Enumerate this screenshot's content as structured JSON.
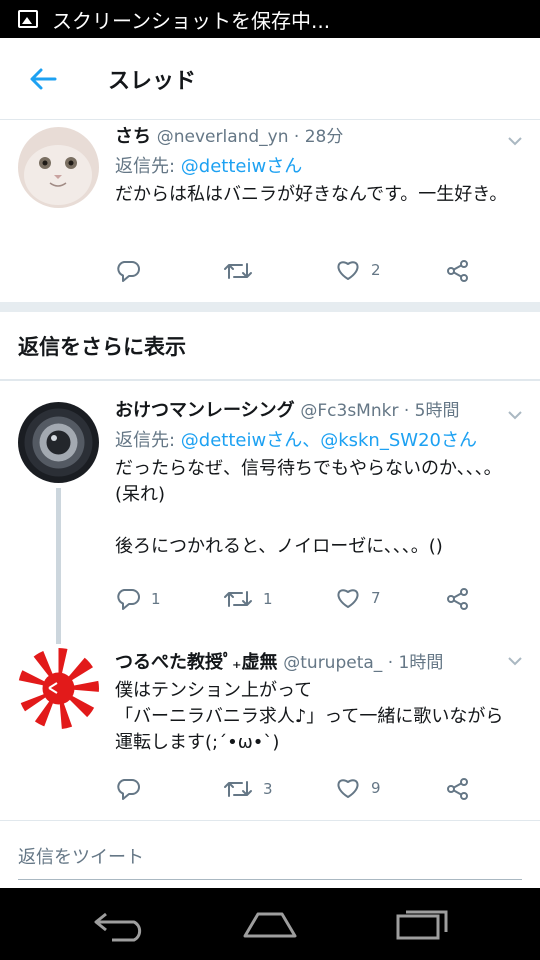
{
  "status_bar": {
    "text": "スクリーンショットを保存中..."
  },
  "app_bar": {
    "title": "スレッド"
  },
  "tweets": [
    {
      "name": "さち",
      "meta": "@neverland_yn · 28分",
      "reply_prefix": "返信先: ",
      "reply_mentions": "@detteiwさん",
      "body": "だからは私はバニラが好きなんです。一生好き。",
      "replies": "",
      "retweets": "",
      "likes": "2"
    },
    {
      "name": "おけつマンレーシング",
      "meta": " @Fc3sMnkr · 5時間",
      "reply_prefix": "返信先: ",
      "reply_mentions": "@detteiwさん、@kskn_SW20さん",
      "body": "だったらなぜ、信号待ちでもやらないのか、、、。(呆れ)\n\n後ろにつかれると、ノイローゼに、、、。()",
      "replies": "1",
      "retweets": "1",
      "likes": "7"
    },
    {
      "name": "つるぺた教授ﾟ₊虚無",
      "meta": " @turupeta_ · 1時間",
      "body": "僕はテンション上がって\n「バーニラバニラ求人♪」って一緒に歌いながら運転します(;´•ω•`)",
      "replies": "",
      "retweets": "3",
      "likes": "9"
    }
  ],
  "show_more": "返信をさらに表示",
  "reply_box": {
    "placeholder": "返信をツイート"
  },
  "colors": {
    "accent": "#1da1f2",
    "secondary_text": "#657786",
    "divider": "#e6ecf0"
  },
  "icons": [
    "image-icon",
    "back-arrow-icon",
    "chevron-down-icon",
    "reply-icon",
    "retweet-icon",
    "like-icon",
    "share-icon",
    "nav-back-icon",
    "nav-home-icon",
    "nav-recents-icon"
  ]
}
